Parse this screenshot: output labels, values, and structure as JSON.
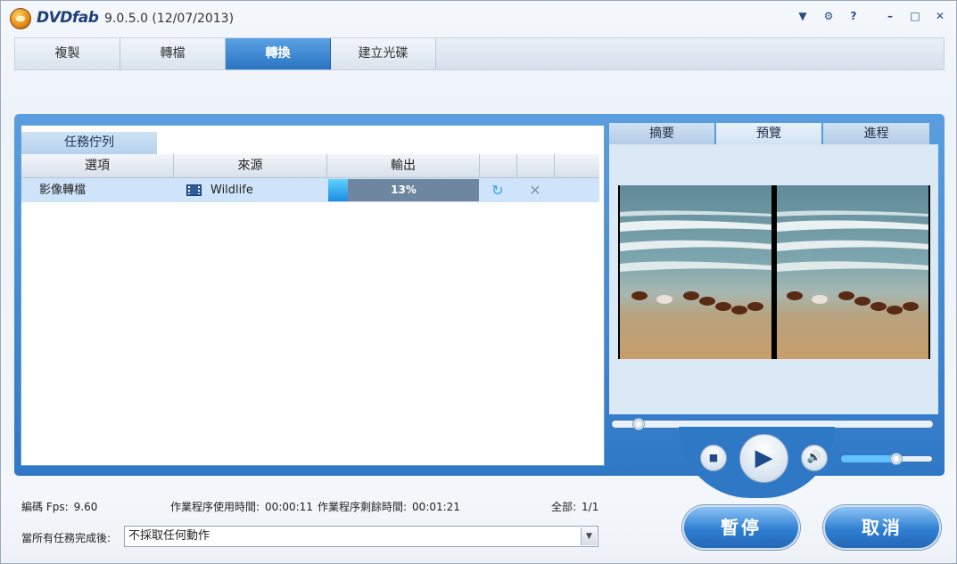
{
  "app": {
    "brand": "DVDfab",
    "version": "9.0.5.0 (12/07/2013)"
  },
  "titlebar": {
    "icons": [
      "dropdown-menu-icon",
      "settings-icon",
      "help-icon",
      "minimize-icon",
      "maximize-icon",
      "close-icon"
    ]
  },
  "tabs": [
    {
      "label": "複製",
      "active": false
    },
    {
      "label": "轉檔",
      "active": false
    },
    {
      "label": "轉換",
      "active": true
    },
    {
      "label": "建立光碟",
      "active": false
    }
  ],
  "queue": {
    "title": "任務佇列",
    "columns": [
      "選項",
      "來源",
      "輸出"
    ],
    "rows": [
      {
        "option": "影像轉檔",
        "source": "Wildlife",
        "progress_text": "13%",
        "progress_value": 0.13
      }
    ]
  },
  "right_panel": {
    "tabs": [
      {
        "label": "摘要",
        "active": false
      },
      {
        "label": "預覽",
        "active": true
      },
      {
        "label": "進程",
        "active": false
      }
    ],
    "seek_value": 0.07,
    "volume_value": 0.62
  },
  "status": {
    "fps_label": "編碼 Fps:",
    "fps_value": "9.60",
    "elapsed_label": "作業程序使用時間:",
    "elapsed_value": "00:00:11",
    "remaining_label": "作業程序剩餘時間:",
    "remaining_value": "00:01:21",
    "total_label": "全部:",
    "total_value": "1/1"
  },
  "after_done": {
    "label": "當所有任務完成後:",
    "selected": "不採取任何動作"
  },
  "buttons": {
    "pause": "暫停",
    "cancel": "取消"
  },
  "colors": {
    "accent": "#2f78c6",
    "progress_fill": "#1a8de0",
    "selected_row": "#cfe4fb"
  }
}
